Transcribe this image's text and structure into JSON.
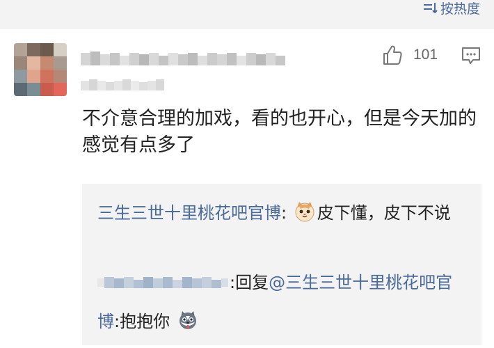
{
  "toolbar": {
    "sort_label": "按热度",
    "sort_icon": "sort-icon"
  },
  "comment": {
    "author": "",
    "time": "",
    "likes": "101",
    "text": "不介意合理的加戏，看的也开心，但是今天加的感觉有点多了",
    "like_icon": "thumbs-up-icon",
    "reply_icon": "comment-icon"
  },
  "replies": [
    {
      "author": "三生三世十里桃花吧官博",
      "separator": ":",
      "emoji": "cat-emoji",
      "text": "皮下懂，皮下不说"
    },
    {
      "author": "",
      "separator": ":回复",
      "mention": "@三生三世十里桃花吧官博",
      "separator2": ":",
      "text": "抱抱你",
      "emoji": "husky-emoji"
    }
  ],
  "colors": {
    "link": "#4a6a99",
    "text": "#222222",
    "muted": "#666666",
    "panel": "#f3f3f3"
  }
}
